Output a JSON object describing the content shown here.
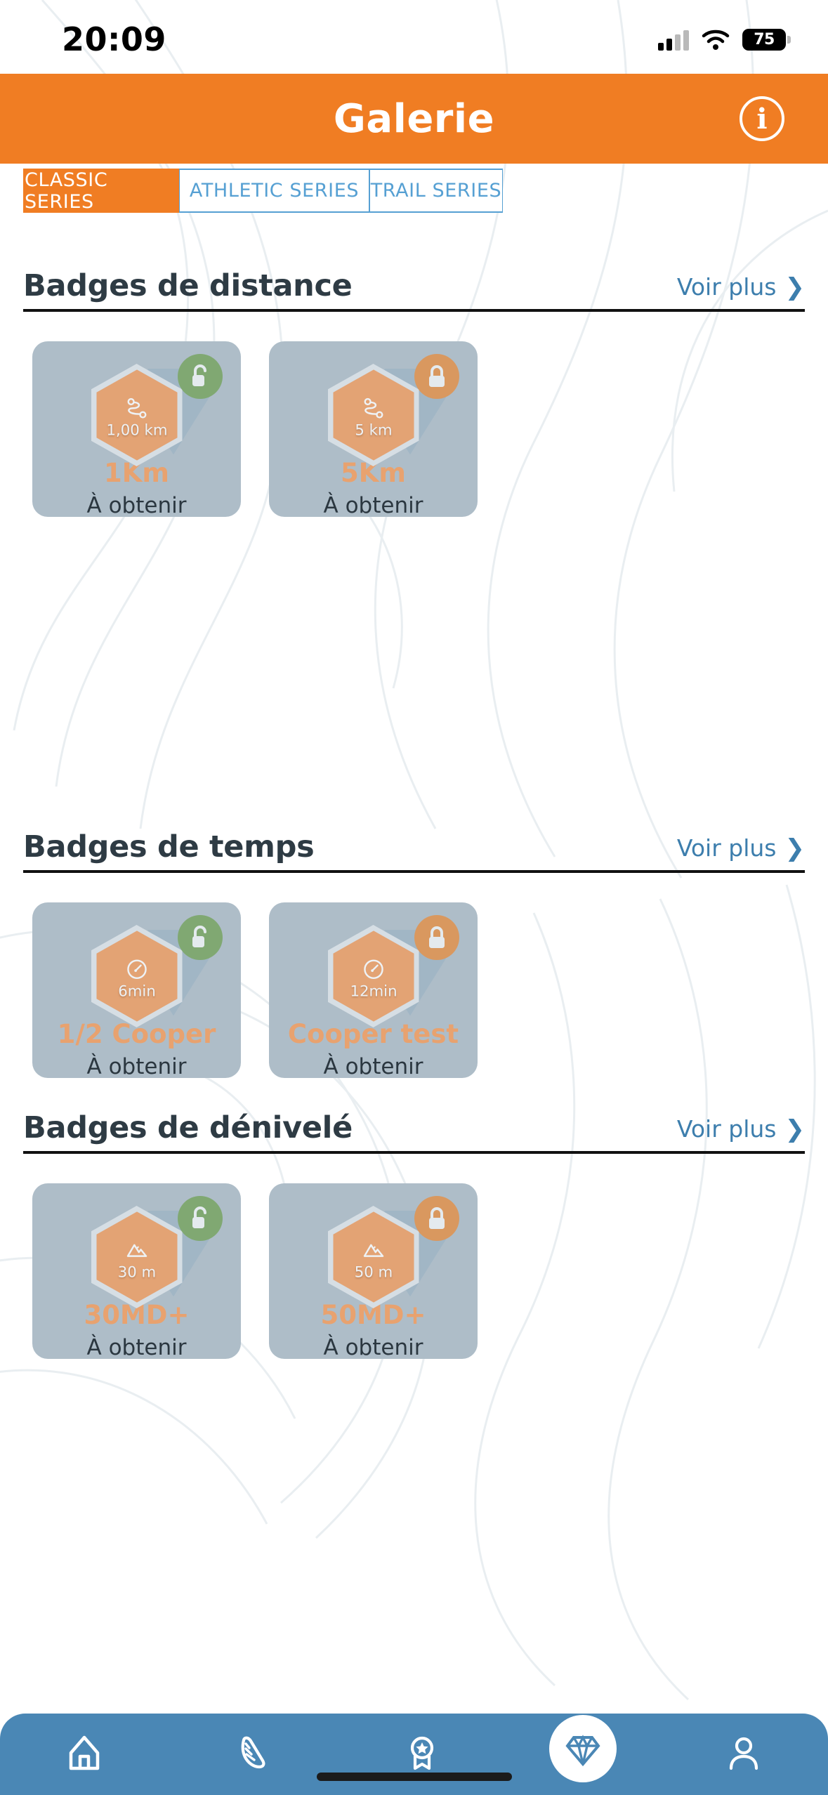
{
  "status_bar": {
    "time": "20:09",
    "battery_level": "75",
    "signal_icon": "cellular-signal-icon",
    "wifi_icon": "wifi-icon",
    "battery_icon": "battery-icon"
  },
  "header": {
    "title": "Galerie",
    "info_icon": "info-icon",
    "background_color": "#f07d23"
  },
  "tabs": {
    "active_index": 0,
    "items": [
      {
        "label": "CLASSIC SERIES",
        "active": true
      },
      {
        "label": "ATHLETIC SERIES",
        "active": false
      },
      {
        "label": "TRAIL SERIES",
        "active": false
      }
    ],
    "active_color": "#f07d23",
    "inactive_color": "#56a0d3"
  },
  "see_more_label": "Voir plus",
  "see_more_icon": "chevron-right-icon",
  "sections": [
    {
      "title": "Badges de distance",
      "see_more": "Voir plus",
      "cards": [
        {
          "title": "1Km",
          "status": "À obtenir",
          "hex_value": "1,00 km",
          "hex_icon": "route-icon",
          "lock_icon": "unlock-icon",
          "lock_state": "unlocked",
          "lock_color": "#80a872"
        },
        {
          "title": "5Km",
          "status": "À obtenir",
          "hex_value": "5 km",
          "hex_icon": "route-icon",
          "lock_icon": "lock-icon",
          "lock_state": "locked",
          "lock_color": "#d9985f"
        }
      ]
    },
    {
      "title": "Badges de temps",
      "see_more": "Voir plus",
      "cards": [
        {
          "title": "1/2 Cooper",
          "status": "À obtenir",
          "hex_value": "6min",
          "hex_icon": "speedometer-icon",
          "lock_icon": "unlock-icon",
          "lock_state": "unlocked",
          "lock_color": "#80a872"
        },
        {
          "title": "Cooper test",
          "status": "À obtenir",
          "hex_value": "12min",
          "hex_icon": "speedometer-icon",
          "lock_icon": "lock-icon",
          "lock_state": "locked",
          "lock_color": "#d9985f"
        }
      ]
    },
    {
      "title": "Badges de dénivelé",
      "see_more": "Voir plus",
      "cards": [
        {
          "title": "30MD+",
          "status": "À obtenir",
          "hex_value": "30 m",
          "hex_icon": "mountain-icon",
          "lock_icon": "unlock-icon",
          "lock_state": "unlocked",
          "lock_color": "#80a872"
        },
        {
          "title": "50MD+",
          "status": "À obtenir",
          "hex_value": "50 m",
          "hex_icon": "mountain-icon",
          "lock_icon": "lock-icon",
          "lock_state": "locked",
          "lock_color": "#d9985f"
        }
      ]
    }
  ],
  "bottom_nav": {
    "background_color": "#4a87b5",
    "active_index": 3,
    "items": [
      {
        "icon": "home-icon",
        "active": false
      },
      {
        "icon": "running-shoe-icon",
        "active": false
      },
      {
        "icon": "award-medal-icon",
        "active": false
      },
      {
        "icon": "diamond-icon",
        "active": true
      },
      {
        "icon": "user-profile-icon",
        "active": false
      }
    ]
  },
  "theme": {
    "orange": "#f07d23",
    "badge_orange": "#e3a374",
    "card_grey_blue": "#aebdc8",
    "nav_blue": "#4a87b5",
    "link_blue": "#3d7ead",
    "text_dark": "#2e3b44"
  }
}
